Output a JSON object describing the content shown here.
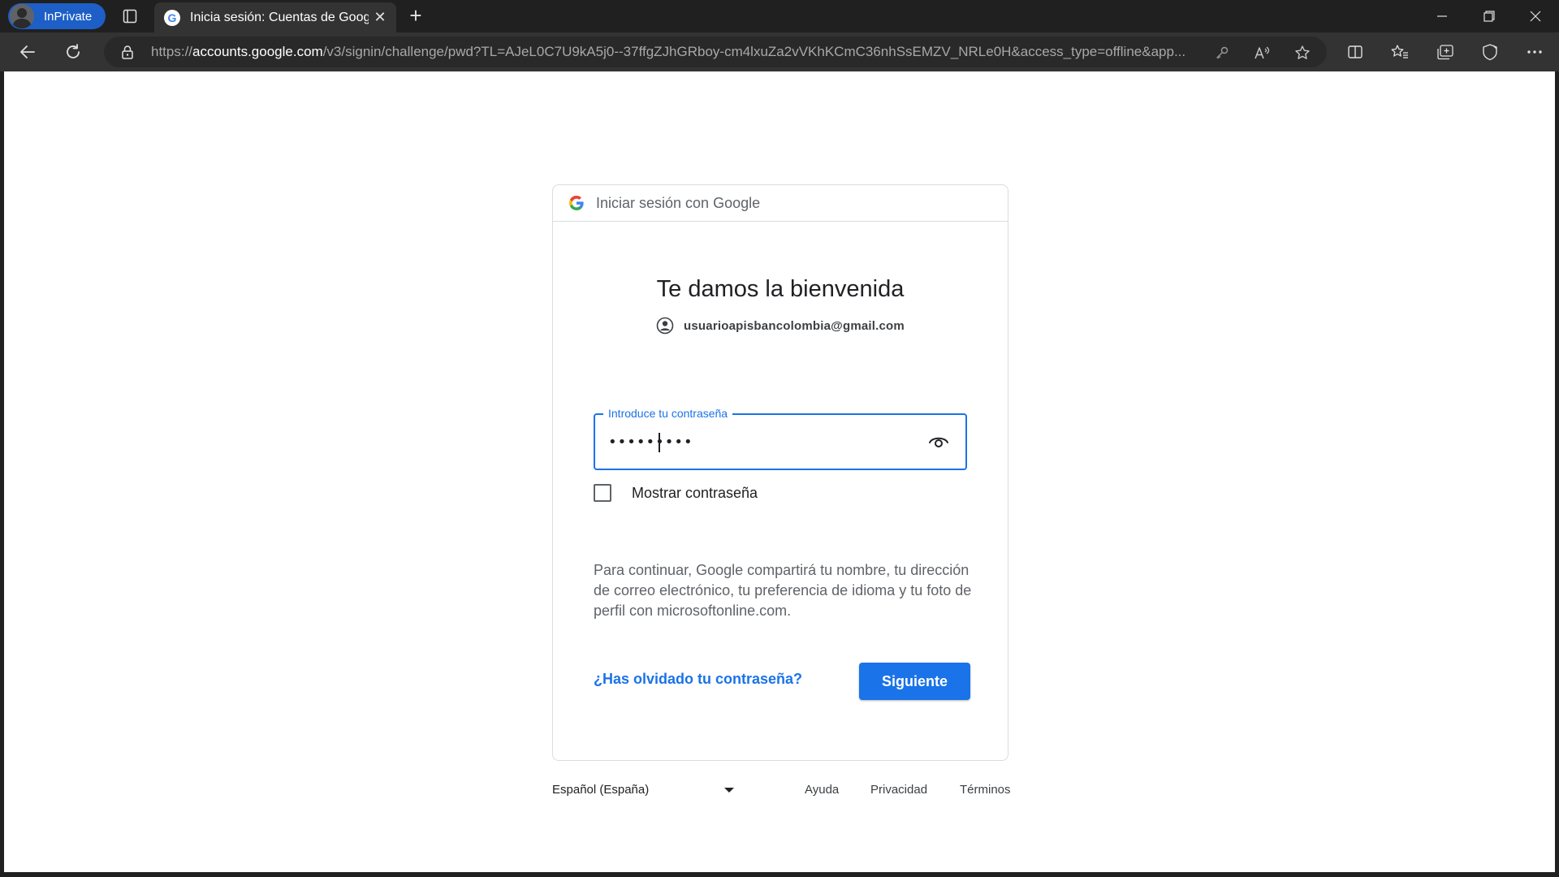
{
  "browser": {
    "profile_label": "InPrivate",
    "tab": {
      "title": "Inicia sesión: Cuentas de Google",
      "close": "✕"
    },
    "new_tab": "+",
    "url": {
      "scheme": "https://",
      "host": "accounts.google.com",
      "path": "/v3/signin/challenge/pwd?TL=AJeL0C7U9kA5j0--37ffgZJhGRboy-cm4lxuZa2vVKhKCmC36nhSsEMZV_NRLe0H&access_type=offline&app..."
    },
    "icons": [
      "tab-actions-icon",
      "back-icon",
      "refresh-icon",
      "lock-icon",
      "key-icon",
      "read-aloud-icon",
      "favorite-star-icon",
      "split-screen-icon",
      "favorites-icon",
      "collections-icon",
      "browser-essentials-icon",
      "more-icon",
      "minimize-icon",
      "restore-icon",
      "close-window-icon"
    ]
  },
  "card": {
    "header": "Iniciar sesión con Google",
    "title": "Te damos la bienvenida",
    "email": "usuarioapisbancolombia@gmail.com",
    "password_label": "Introduce tu contraseña",
    "password_value": "•••••••••",
    "show_password_label": "Mostrar contraseña",
    "disclaimer": "Para continuar, Google compartirá tu nombre, tu dirección de correo electrónico, tu preferencia de idioma y tu foto de perfil con microsoftonline.com.",
    "forgot_link": "¿Has olvidado tu contraseña?",
    "next_button": "Siguiente"
  },
  "footer": {
    "language": "Español (España)",
    "links": [
      "Ayuda",
      "Privacidad",
      "Términos"
    ]
  },
  "colors": {
    "accent": "#1a73e8",
    "inprivate": "#1d5fc7",
    "chrome_dark": "#202020",
    "toolbar": "#333333"
  }
}
